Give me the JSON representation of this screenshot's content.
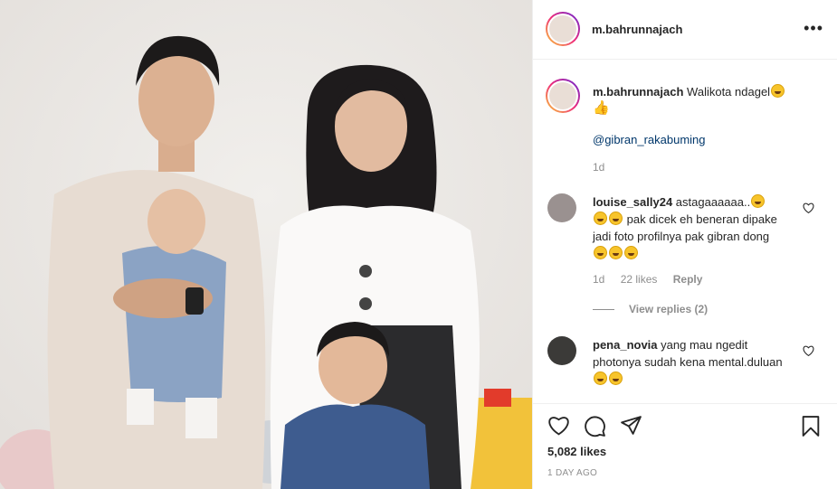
{
  "post": {
    "username": "m.bahrunnajach",
    "caption_text": "Walikota ndagel",
    "caption_tag": "@gibran_rakabuming",
    "caption_time": "1d",
    "likes": "5,082 likes",
    "posted": "1 DAY AGO"
  },
  "comments": [
    {
      "username": "louise_sally24",
      "text_a": "astagaaaaaa..",
      "text_b": "pak dicek eh beneran dipake jadi foto profilnya pak gibran dong",
      "time": "1d",
      "likes": "22 likes",
      "reply": "Reply",
      "view_replies": "View replies (2)"
    },
    {
      "username": "pena_novia",
      "text_a": "yang mau ngedit photonya sudah kena mental.duluan",
      "text_b": ""
    }
  ],
  "icons": {
    "more": "more-options-icon",
    "heart": "heart-icon",
    "comment": "comment-icon",
    "share": "share-icon",
    "save": "bookmark-icon"
  },
  "colors": {
    "link": "#00376b",
    "muted": "#8e8e8e",
    "border": "#efefef"
  }
}
